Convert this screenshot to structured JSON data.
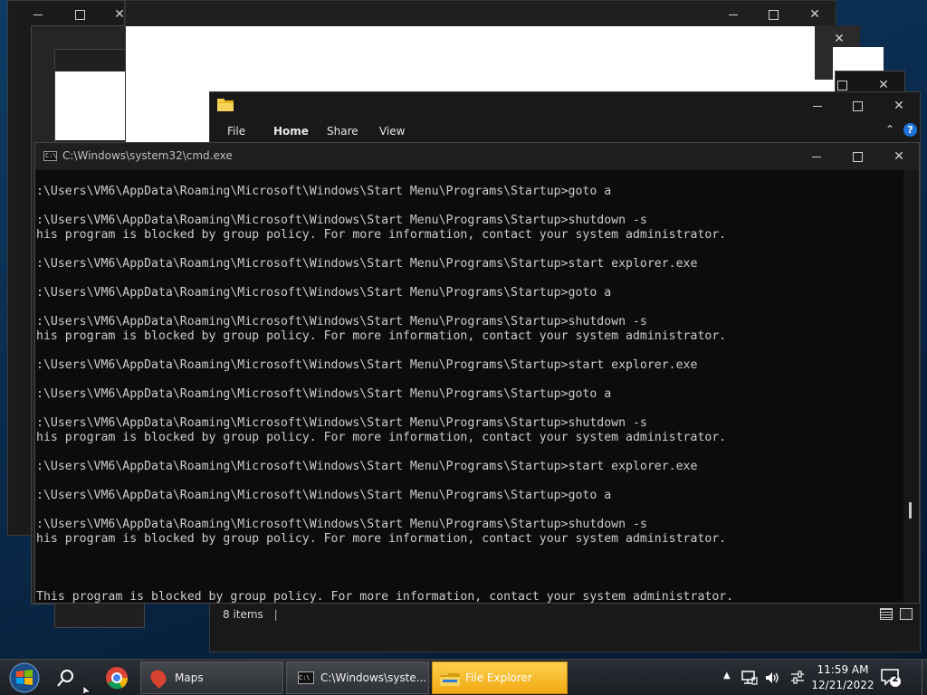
{
  "cmd_window": {
    "title": "C:\\Windows\\system32\\cmd.exe",
    "lines": [
      "",
      ":\\Users\\VM6\\AppData\\Roaming\\Microsoft\\Windows\\Start Menu\\Programs\\Startup>goto a",
      "",
      ":\\Users\\VM6\\AppData\\Roaming\\Microsoft\\Windows\\Start Menu\\Programs\\Startup>shutdown -s",
      "his program is blocked by group policy. For more information, contact your system administrator.",
      "",
      ":\\Users\\VM6\\AppData\\Roaming\\Microsoft\\Windows\\Start Menu\\Programs\\Startup>start explorer.exe",
      "",
      ":\\Users\\VM6\\AppData\\Roaming\\Microsoft\\Windows\\Start Menu\\Programs\\Startup>goto a",
      "",
      ":\\Users\\VM6\\AppData\\Roaming\\Microsoft\\Windows\\Start Menu\\Programs\\Startup>shutdown -s",
      "his program is blocked by group policy. For more information, contact your system administrator.",
      "",
      ":\\Users\\VM6\\AppData\\Roaming\\Microsoft\\Windows\\Start Menu\\Programs\\Startup>start explorer.exe",
      "",
      ":\\Users\\VM6\\AppData\\Roaming\\Microsoft\\Windows\\Start Menu\\Programs\\Startup>goto a",
      "",
      ":\\Users\\VM6\\AppData\\Roaming\\Microsoft\\Windows\\Start Menu\\Programs\\Startup>shutdown -s",
      "his program is blocked by group policy. For more information, contact your system administrator.",
      "",
      ":\\Users\\VM6\\AppData\\Roaming\\Microsoft\\Windows\\Start Menu\\Programs\\Startup>start explorer.exe",
      "",
      ":\\Users\\VM6\\AppData\\Roaming\\Microsoft\\Windows\\Start Menu\\Programs\\Startup>goto a",
      "",
      ":\\Users\\VM6\\AppData\\Roaming\\Microsoft\\Windows\\Start Menu\\Programs\\Startup>shutdown -s",
      "his program is blocked by group policy. For more information, contact your system administrator.",
      "",
      "",
      "",
      "This program is blocked by group policy. For more information, contact your system administrator."
    ]
  },
  "explorer_window": {
    "tabs": [
      "File",
      "Home",
      "Share",
      "View"
    ],
    "status_items": "8 items"
  },
  "taskbar": {
    "items": [
      {
        "label": "Maps",
        "icon": "maps-icon"
      },
      {
        "label": "C:\\Windows\\syste...",
        "icon": "cmd-icon"
      },
      {
        "label": "File Explorer",
        "icon": "folder-icon",
        "active": true
      }
    ],
    "time": "11:59 AM",
    "date": "12/21/2022",
    "notification_count": "2"
  },
  "colors": {
    "active_task": "#f2a912",
    "console_text": "#cccccc",
    "help_blue": "#1e73d8"
  }
}
